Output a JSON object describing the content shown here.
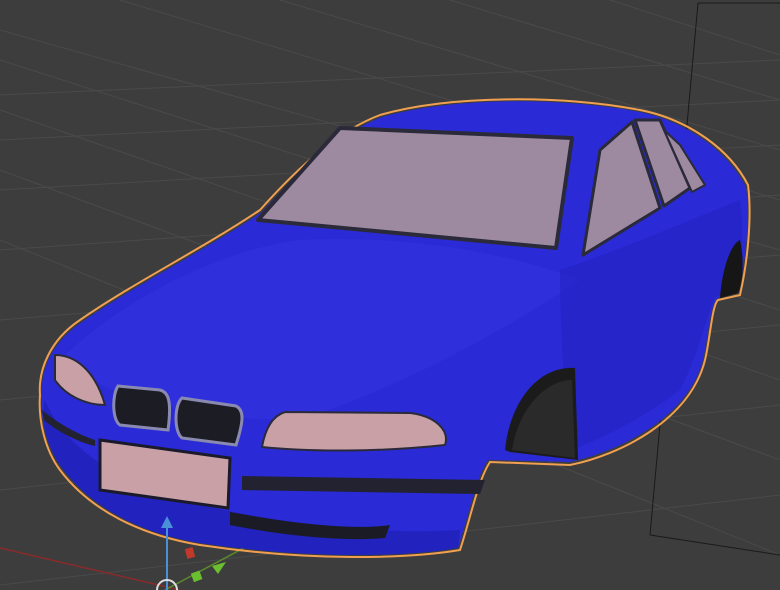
{
  "app": {
    "view": "3D Viewport",
    "shading": "solid"
  },
  "scene": {
    "object": {
      "selected": true
    },
    "grid": true,
    "gizmo_axes": [
      "x",
      "y",
      "z"
    ]
  },
  "colors": {
    "background": "#3d3d3d",
    "grid_line": "#4a4a4a",
    "car_body": "#2a2ad6",
    "car_body_light": "#3b3be8",
    "car_body_dark": "#1e1eaa",
    "glass": "#9e8aa0",
    "headlight": "#c8a0a6",
    "selection_outline": "#f0a050",
    "x_axis": "#c0392b",
    "y_axis": "#6bbf2f",
    "z_axis": "#4a90d9"
  }
}
